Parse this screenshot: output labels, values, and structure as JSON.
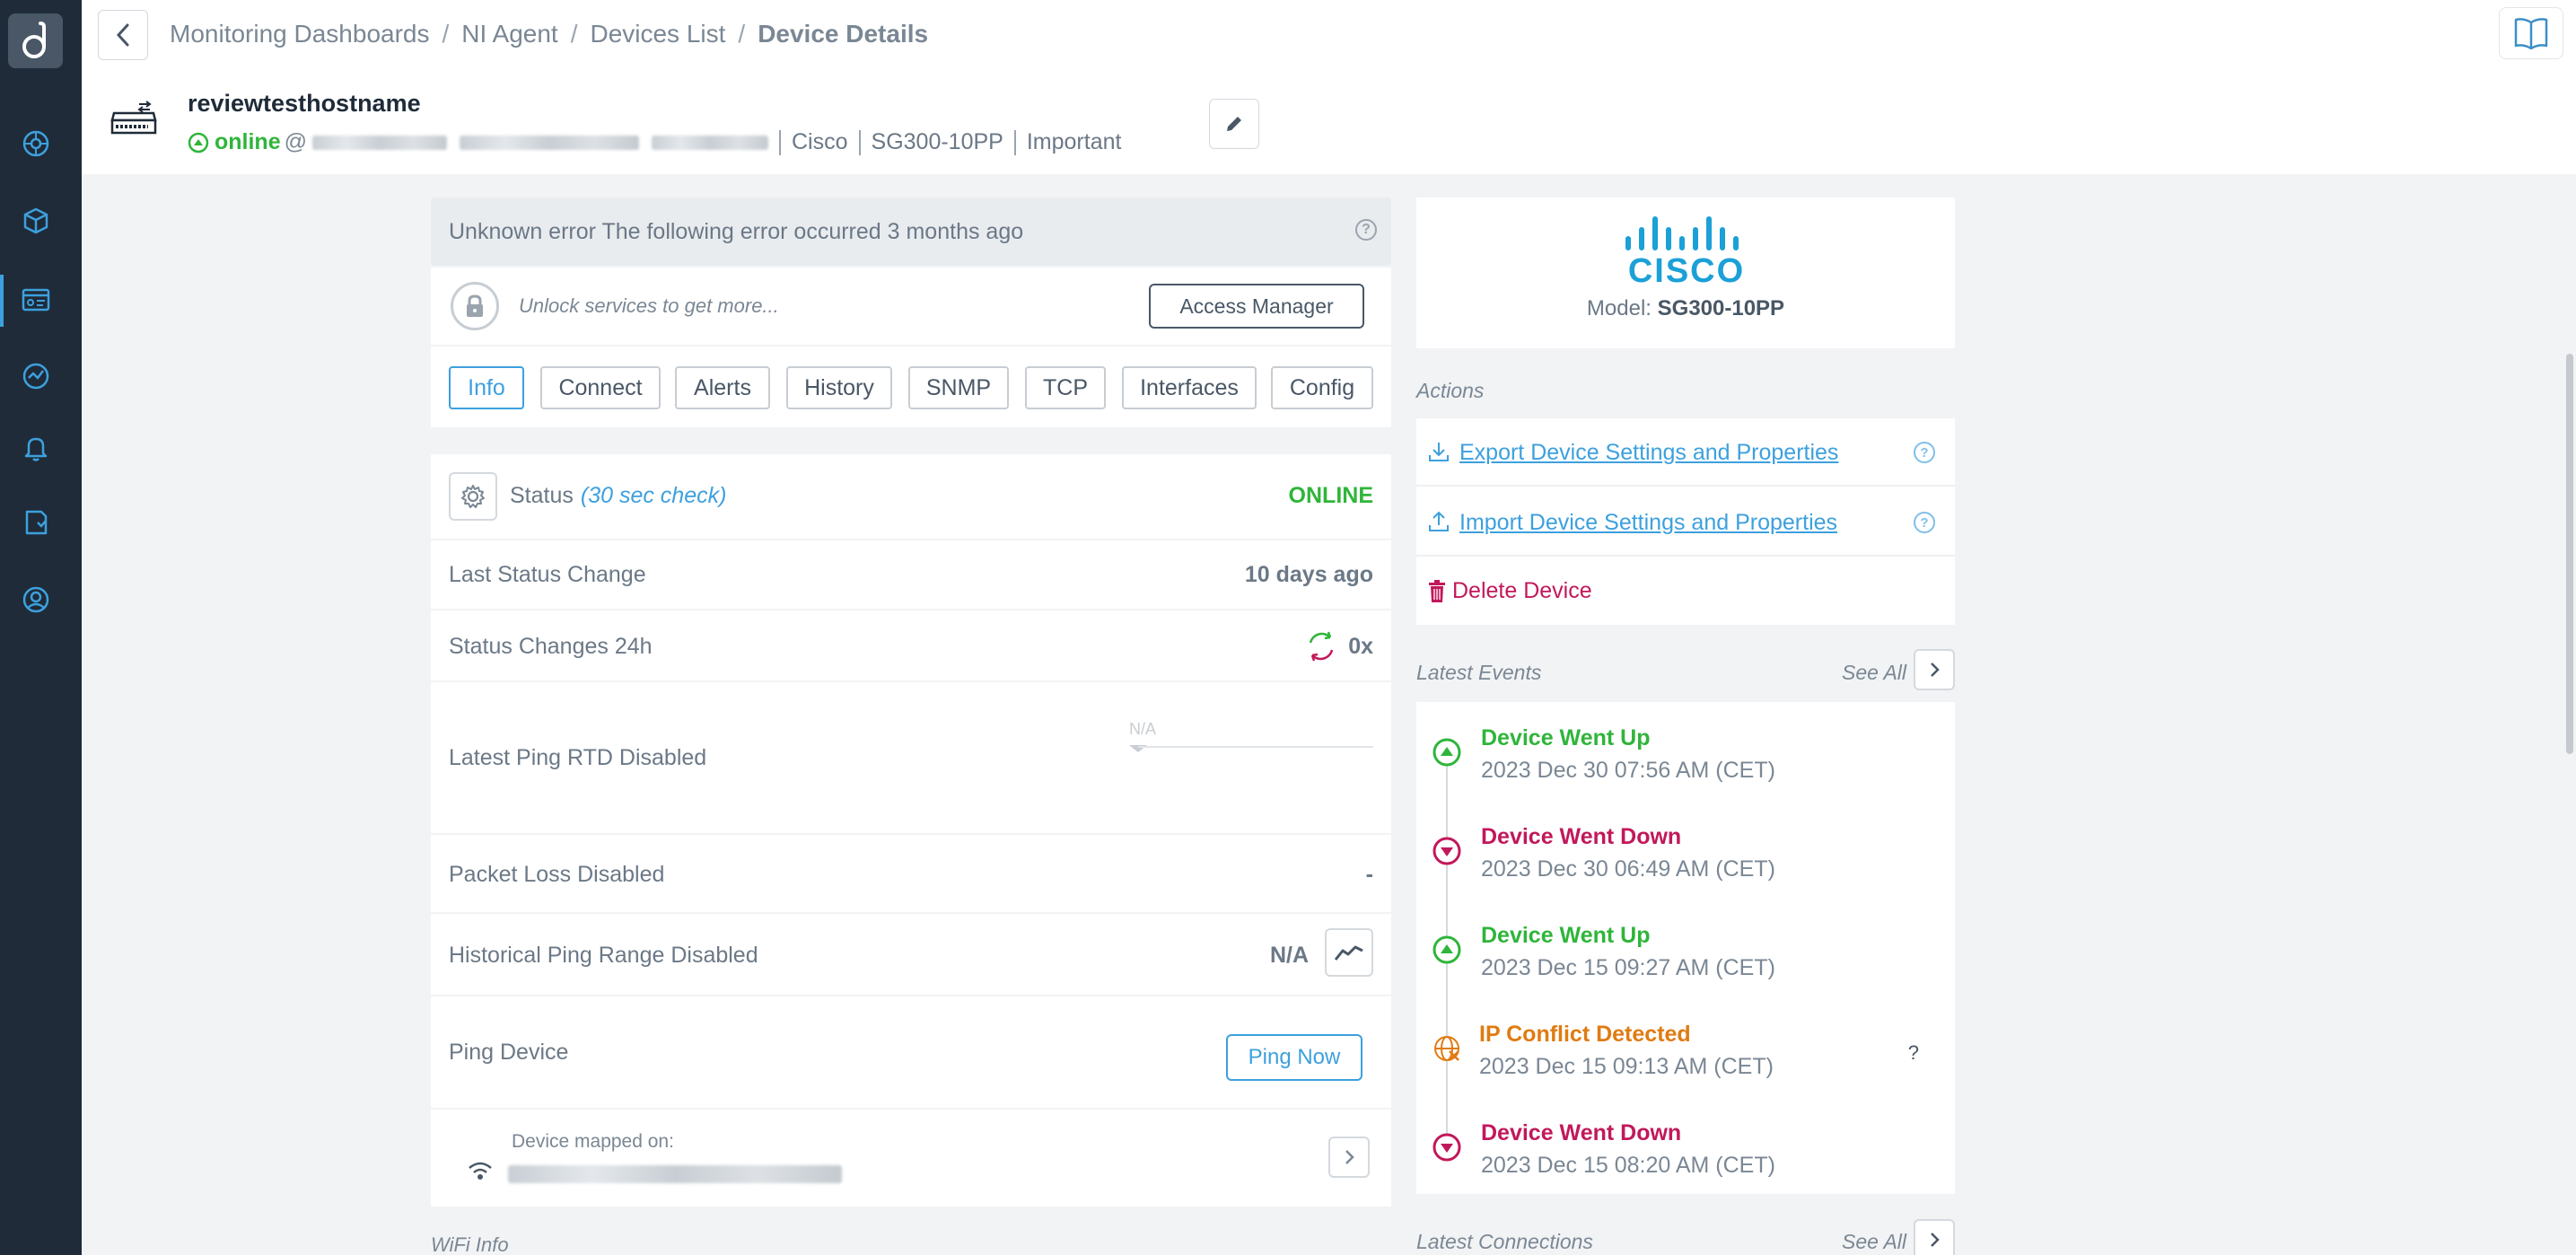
{
  "breadcrumb": {
    "items": [
      "Monitoring Dashboards",
      "NI Agent",
      "Devices List"
    ],
    "current": "Device Details",
    "separator": "/"
  },
  "device": {
    "hostname": "reviewtesthostname",
    "status": "online",
    "at": "@",
    "vendor": "Cisco",
    "model": "SG300-10PP",
    "importance": "Important"
  },
  "error_banner": {
    "text": "Unknown error The following error occurred 3 months ago",
    "help": "?"
  },
  "unlock": {
    "text": "Unlock services to get more...",
    "button": "Access Manager"
  },
  "tabs": [
    "Info",
    "Connect",
    "Alerts",
    "History",
    "SNMP",
    "TCP",
    "Interfaces",
    "Config"
  ],
  "active_tab": "Info",
  "status_section": {
    "status_label": "Status",
    "check_interval": "(30 sec check)",
    "status_value": "ONLINE",
    "last_status_change_label": "Last Status Change",
    "last_status_change_value": "10 days ago",
    "status_changes_label": "Status Changes 24h",
    "status_changes_value": "0x",
    "latest_ping_label": "Latest Ping RTD Disabled",
    "latest_ping_chart_value": "N/A",
    "packet_loss_label": "Packet Loss Disabled",
    "packet_loss_value": "-",
    "historical_ping_label": "Historical Ping Range Disabled",
    "historical_ping_value": "N/A",
    "ping_device_label": "Ping Device",
    "ping_button": "Ping Now"
  },
  "mapped": {
    "label": "Device mapped on:"
  },
  "wifi_info_title": "WiFi Info",
  "vendor_card": {
    "logo_text": "CISCO",
    "model_prefix": "Model:",
    "model_value": "SG300-10PP"
  },
  "actions": {
    "title": "Actions",
    "export": "Export Device Settings and Properties",
    "import": "Import Device Settings and Properties",
    "delete": "Delete Device",
    "help": "?"
  },
  "latest_events": {
    "title": "Latest Events",
    "see_all": "See All",
    "items": [
      {
        "type": "up",
        "title": "Device Went Up",
        "time": "2023 Dec 30 07:56 AM (CET)"
      },
      {
        "type": "down",
        "title": "Device Went Down",
        "time": "2023 Dec 30 06:49 AM (CET)"
      },
      {
        "type": "up",
        "title": "Device Went Up",
        "time": "2023 Dec 15 09:27 AM (CET)"
      },
      {
        "type": "conflict",
        "title": "IP Conflict Detected",
        "time": "2023 Dec 15 09:13 AM (CET)",
        "help": "?"
      },
      {
        "type": "down",
        "title": "Device Went Down",
        "time": "2023 Dec 15 08:20 AM (CET)"
      }
    ]
  },
  "latest_connections": {
    "title": "Latest Connections",
    "see_all": "See All"
  },
  "colors": {
    "accent": "#3da0de",
    "online": "#2fb53a",
    "down": "#c2185b",
    "warning": "#e07b12",
    "sidebar": "#1f2b38",
    "cisco": "#1ba0d7"
  }
}
